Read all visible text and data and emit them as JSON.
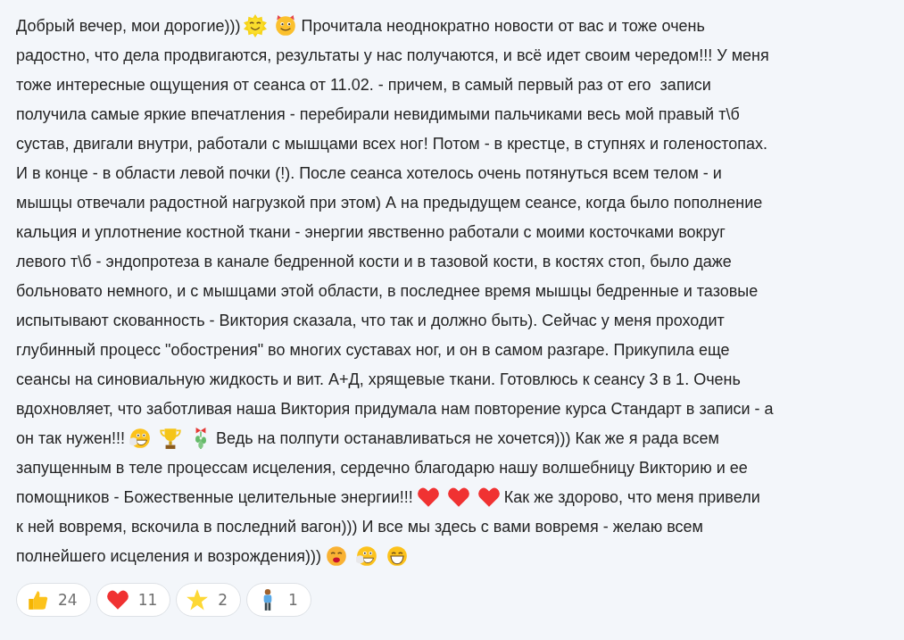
{
  "comment": {
    "lines": [
      [
        {
          "kind": "text",
          "text": "Добрый вечер, мои дорогие)))"
        },
        {
          "kind": "sun"
        },
        {
          "kind": "devil"
        },
        {
          "kind": "text",
          "text": "Прочитала неоднократно новости от вас и тоже очень"
        }
      ],
      [
        {
          "kind": "text",
          "text": "радостно, что дела продвигаются, результаты у нас получаются, и всё идет своим чередом!!! У меня"
        }
      ],
      [
        {
          "kind": "text",
          "text": "тоже интересные ощущения от сеанса от 11.02. - причем, в самый первый раз от его  записи"
        }
      ],
      [
        {
          "kind": "text",
          "text": "получила самые яркие впечатления - перебирали невидимыми пальчиками весь мой правый т\\б"
        }
      ],
      [
        {
          "kind": "text",
          "text": "сустав, двигали внутри, работали с мышцами всех ног! Потом - в крестце, в ступнях и голеностопах."
        }
      ],
      [
        {
          "kind": "text",
          "text": "И в конце - в области левой почки (!). После сеанса хотелось очень потянуться всем телом - и"
        }
      ],
      [
        {
          "kind": "text",
          "text": "мышцы отвечали радостной нагрузкой при этом) А на предыдущем сеансе, когда было пополнение"
        }
      ],
      [
        {
          "kind": "text",
          "text": "кальция и уплотнение костной ткани - энергии явственно работали с моими косточками вокруг"
        }
      ],
      [
        {
          "kind": "text",
          "text": "левого т\\б - эндопротеза в канале бедренной кости и в тазовой кости, в костях стоп, было даже"
        }
      ],
      [
        {
          "kind": "text",
          "text": "больновато немного, и с мышцами этой области, в последнее время мышцы бедренные и тазовые"
        }
      ],
      [
        {
          "kind": "text",
          "text": "испытывают скованность - Виктория сказала, что так и должно быть). Сейчас у меня проходит"
        }
      ],
      [
        {
          "kind": "text",
          "text": "глубинный процесс \"обострения\" во многих суставах ног, и он в самом разгаре. Прикупила еще"
        }
      ],
      [
        {
          "kind": "text",
          "text": "сеансы на синовиальную жидкость и вит. А+Д, хрящевые ткани. Готовлюсь к сеансу 3 в 1. Очень"
        }
      ],
      [
        {
          "kind": "text",
          "text": "вдохновляет, что заботливая наша Виктория придумала нам повторение курса Стандарт в записи - а"
        }
      ],
      [
        {
          "kind": "text",
          "text": "он так нужен!!!"
        },
        {
          "kind": "laugh"
        },
        {
          "kind": "trophy"
        },
        {
          "kind": "mistletoe"
        },
        {
          "kind": "text",
          "text": "Ведь на полпути останавливаться не хочется))) Как же я рада всем"
        }
      ],
      [
        {
          "kind": "text",
          "text": "запущенным в теле процессам исцеления, сердечно благодарю нашу волшебницу Викторию и ее"
        }
      ],
      [
        {
          "kind": "text",
          "text": "помощников - Божественные целительные энергии!!!"
        },
        {
          "kind": "heart"
        },
        {
          "kind": "heart"
        },
        {
          "kind": "heart"
        },
        {
          "kind": "text",
          "text": "Как же здорово, что меня привели"
        }
      ],
      [
        {
          "kind": "text",
          "text": "к ней вовремя, вскочила в последний вагон))) И все мы здесь с вами вовремя - желаю всем"
        }
      ],
      [
        {
          "kind": "text",
          "text": "полнейшего исцеления и возрождения)))"
        },
        {
          "kind": "kiss"
        },
        {
          "kind": "laugh"
        },
        {
          "kind": "grin"
        }
      ]
    ]
  },
  "reactions": [
    {
      "kind": "thumbs-up",
      "count": "24"
    },
    {
      "kind": "heart",
      "count": "11"
    },
    {
      "kind": "star",
      "count": "2"
    },
    {
      "kind": "person",
      "count": "1"
    }
  ]
}
